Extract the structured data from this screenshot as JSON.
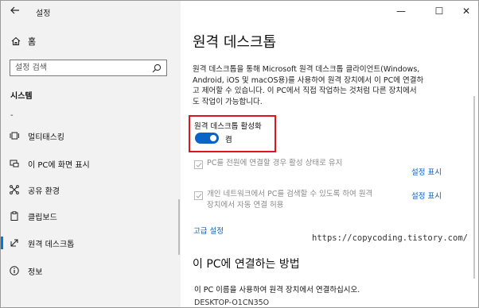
{
  "window": {
    "title": "설정",
    "back_icon": "arrow-left-icon",
    "minimize_glyph": "—",
    "maximize_glyph": "☐",
    "close_glyph": "✕"
  },
  "sidebar": {
    "home_label": "홈",
    "search_placeholder": "설정 검색",
    "section_title": "시스템",
    "dash_text": "-",
    "items": [
      {
        "label": "멀티태스킹",
        "icon": "multitasking-icon",
        "active": false
      },
      {
        "label": "이 PC에 화면 표시",
        "icon": "project-icon",
        "active": false
      },
      {
        "label": "공유 환경",
        "icon": "shared-experiences-icon",
        "active": false
      },
      {
        "label": "클립보드",
        "icon": "clipboard-icon",
        "active": false
      },
      {
        "label": "원격 데스크톱",
        "icon": "remote-desktop-icon",
        "active": true
      },
      {
        "label": "정보",
        "icon": "info-icon",
        "active": false
      }
    ]
  },
  "main": {
    "title": "원격 데스크톱",
    "description_lines": [
      "원격 데스크톱을 통해 Microsoft 원격 데스크톱 클라이언트(Windows,",
      "Android, iOS 및 macOS용)를 사용하여 원격 장치에서 이 PC에 연결하",
      "고 제어할 수 있습니다. 이 PC에서 직접 작업하는 것처럼 다른 장치에서",
      "도 작업이 가능합니다."
    ],
    "toggle_label": "원격 데스크톱 활성화",
    "toggle_state": "켬",
    "toggle_on": true,
    "check1_text": "PC를 전원에 연결할 경우 활성 상태로 유지",
    "check1_link": "설정 표시",
    "check2_lines": [
      "개인 네트워크에서 PC를 검색할 수 있도록 하여 원격",
      "장치에서 자동 연결 허용"
    ],
    "check2_link": "설정 표시",
    "advanced_link": "고급 설정",
    "watermark": "https://copycoding.tistory.com/",
    "connect_title": "이 PC에 연결하는 방법",
    "connect_text": "이 PC 이름을 사용하여 원격 장치에서 연결하십시오.",
    "pc_name": "DESKTOP-O1CN35O"
  },
  "colors": {
    "accent": "#0a64c8",
    "link": "#0a5ec0",
    "highlight_box": "#e0151b",
    "sidebar_bg": "#f2f2f2"
  }
}
